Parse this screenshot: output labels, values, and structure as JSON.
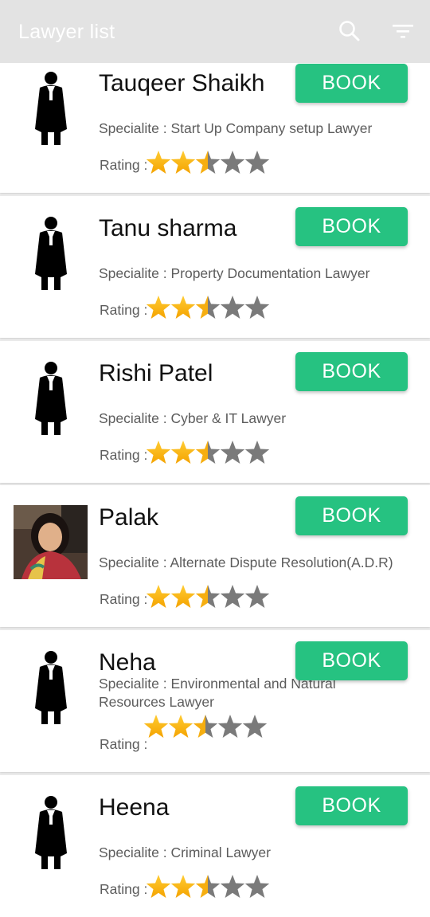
{
  "app": {
    "title": "Lawyer list",
    "icons": {
      "search": "search-icon",
      "filter": "filter-icon"
    },
    "accent": "#26c281"
  },
  "common": {
    "book_label": "BOOK",
    "rating_label": "Rating :",
    "spec_prefix": "Specialite : "
  },
  "lawyers": [
    {
      "name": "Tauqeer Shaikh",
      "speciality": "Specialite : Start Up Company setup Lawyer",
      "rating": 2.5,
      "avatar": "lawyer-silhouette"
    },
    {
      "name": "Tanu sharma",
      "speciality": "Specialite : Property Documentation Lawyer",
      "rating": 2.5,
      "avatar": "lawyer-silhouette"
    },
    {
      "name": "Rishi Patel",
      "speciality": "Specialite : Cyber & IT Lawyer",
      "rating": 2.5,
      "avatar": "lawyer-silhouette"
    },
    {
      "name": "Palak",
      "speciality": "Specialite : Alternate Dispute Resolution(A.D.R)",
      "rating": 2.5,
      "avatar": "photo"
    },
    {
      "name": "Neha",
      "speciality": "Specialite : Environmental and Natural Resources Lawyer",
      "rating": 2.5,
      "avatar": "lawyer-silhouette"
    },
    {
      "name": "Heena",
      "speciality": "Specialite : Criminal Lawyer",
      "rating": 2.5,
      "avatar": "lawyer-silhouette"
    }
  ]
}
